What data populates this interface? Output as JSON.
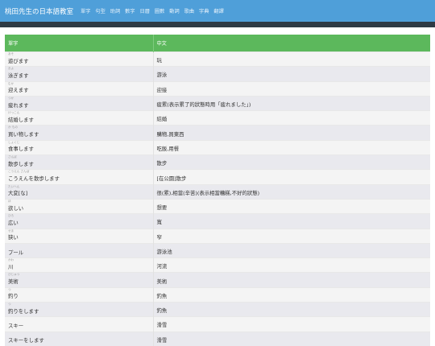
{
  "header": {
    "brand": "桃田先生の日本語教室",
    "nav": [
      "單字",
      "句型",
      "助詞",
      "數字",
      "日曆",
      "圖數",
      "動詞",
      "歌曲",
      "字典",
      "翻譯"
    ]
  },
  "table": {
    "headers": [
      "單字",
      "中文"
    ],
    "rows": [
      {
        "ruby": "あそ",
        "word": "遊びます",
        "meaning": "玩"
      },
      {
        "ruby": "およ",
        "word": "泳ぎます",
        "meaning": "游泳"
      },
      {
        "ruby": "むか",
        "word": "迎えます",
        "meaning": "迎接"
      },
      {
        "ruby": "つか",
        "word": "疲れます",
        "meaning": "疲累(表示累了的狀態時用「疲れました」)"
      },
      {
        "ruby": "けっこん",
        "word": "結婚します",
        "meaning": "結婚"
      },
      {
        "ruby": "か もの",
        "word": "買い物します",
        "meaning": "購物,買東西"
      },
      {
        "ruby": "しょくじ",
        "word": "食事します",
        "meaning": "吃飯,用餐"
      },
      {
        "ruby": "さんぽ",
        "word": "散歩します",
        "meaning": "散步"
      },
      {
        "ruby": "こうえん さんぽ",
        "word": "こうえんを散歩します",
        "meaning": "[在公園]散步"
      },
      {
        "ruby": "たいへん",
        "word": "大変[な]",
        "meaning": "很(累),相當(辛苦)(表示相當糟糕,不好的狀態)"
      },
      {
        "ruby": "ほ",
        "word": "欲しい",
        "meaning": "想要"
      },
      {
        "ruby": "ひろ",
        "word": "広い",
        "meaning": "寬"
      },
      {
        "ruby": "せま",
        "word": "狭い",
        "meaning": "窄"
      },
      {
        "ruby": "",
        "word": "プール",
        "meaning": "游泳池"
      },
      {
        "ruby": "かわ",
        "word": "川",
        "meaning": "河流"
      },
      {
        "ruby": "びじゅつ",
        "word": "美術",
        "meaning": "美術"
      },
      {
        "ruby": "つ",
        "word": "釣り",
        "meaning": "釣魚"
      },
      {
        "ruby": "つ",
        "word": "釣りをします",
        "meaning": "釣魚"
      },
      {
        "ruby": "",
        "word": "スキー",
        "meaning": "滑雪"
      },
      {
        "ruby": "",
        "word": "スキーをします",
        "meaning": "滑雪"
      }
    ]
  }
}
